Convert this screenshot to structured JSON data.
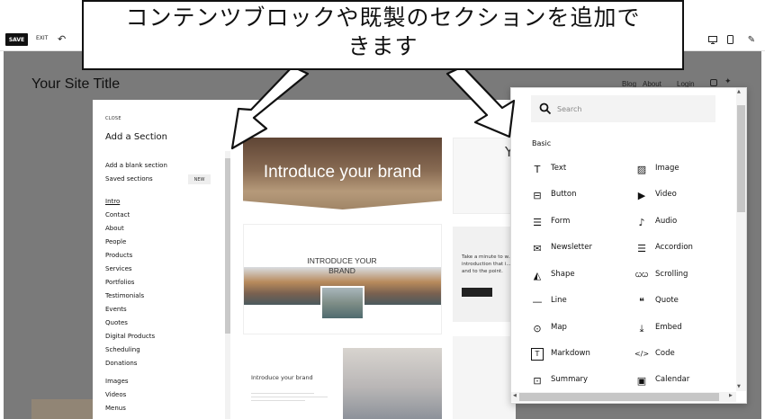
{
  "toolbar": {
    "save_label": "SAVE",
    "exit_label": "EXIT",
    "undo_icon": "undo-icon",
    "desktop_icon": "desktop-icon",
    "mobile_icon": "mobile-icon",
    "style_icon": "paint-brush-icon"
  },
  "site": {
    "title": "Your Site Title",
    "nav": [
      "Blog",
      "About",
      "Login"
    ],
    "social_icons": [
      "instagram-icon",
      "twitter-icon"
    ]
  },
  "add_section_panel": {
    "close_label": "CLOSE",
    "title": "Add a Section",
    "blank_section_label": "Add a blank section",
    "saved_sections_label": "Saved sections",
    "new_badge": "NEW",
    "categories": [
      "Intro",
      "Contact",
      "About",
      "People",
      "Products",
      "Services",
      "Portfolios",
      "Testimonials",
      "Events",
      "Quotes",
      "Digital Products",
      "Scheduling",
      "Donations",
      "Images",
      "Videos",
      "Menus"
    ],
    "active_category": "Intro",
    "thumbnails": {
      "brand_1": "Introduce your brand",
      "brand_2_line1": "INTRODUCE YOUR",
      "brand_2_line2": "BRAND",
      "brand_3": "Introduce your brand",
      "brand_4_letter": "Y",
      "brand_5_text": "Take a minute to w... introduction that i... and to the point."
    }
  },
  "block_picker": {
    "search_placeholder": "Search",
    "section_heading": "Basic",
    "blocks": [
      {
        "label": "Text",
        "icon": "text-icon",
        "glyph": "T"
      },
      {
        "label": "Image",
        "icon": "image-icon",
        "glyph": "▨"
      },
      {
        "label": "Button",
        "icon": "button-icon",
        "glyph": "⊟"
      },
      {
        "label": "Video",
        "icon": "video-icon",
        "glyph": "▶"
      },
      {
        "label": "Form",
        "icon": "form-icon",
        "glyph": "☰"
      },
      {
        "label": "Audio",
        "icon": "audio-icon",
        "glyph": "♪"
      },
      {
        "label": "Newsletter",
        "icon": "newsletter-icon",
        "glyph": "✉"
      },
      {
        "label": "Accordion",
        "icon": "accordion-icon",
        "glyph": "☰"
      },
      {
        "label": "Shape",
        "icon": "shape-icon",
        "glyph": "◭"
      },
      {
        "label": "Scrolling",
        "icon": "scrolling-icon",
        "glyph": "ꞶꞶ"
      },
      {
        "label": "Line",
        "icon": "line-icon",
        "glyph": "—"
      },
      {
        "label": "Quote",
        "icon": "quote-icon",
        "glyph": "❝"
      },
      {
        "label": "Map",
        "icon": "map-pin-icon",
        "glyph": "⊙"
      },
      {
        "label": "Embed",
        "icon": "embed-icon",
        "glyph": "⤓"
      },
      {
        "label": "Markdown",
        "icon": "markdown-icon",
        "glyph": "T"
      },
      {
        "label": "Code",
        "icon": "code-icon",
        "glyph": "</>"
      },
      {
        "label": "Summary",
        "icon": "summary-icon",
        "glyph": "⊡"
      },
      {
        "label": "Calendar",
        "icon": "calendar-icon",
        "glyph": "▣"
      }
    ]
  },
  "callout": {
    "text_line1": "コンテンツブロックや既製のセクションを追加で",
    "text_line2": "きます"
  }
}
